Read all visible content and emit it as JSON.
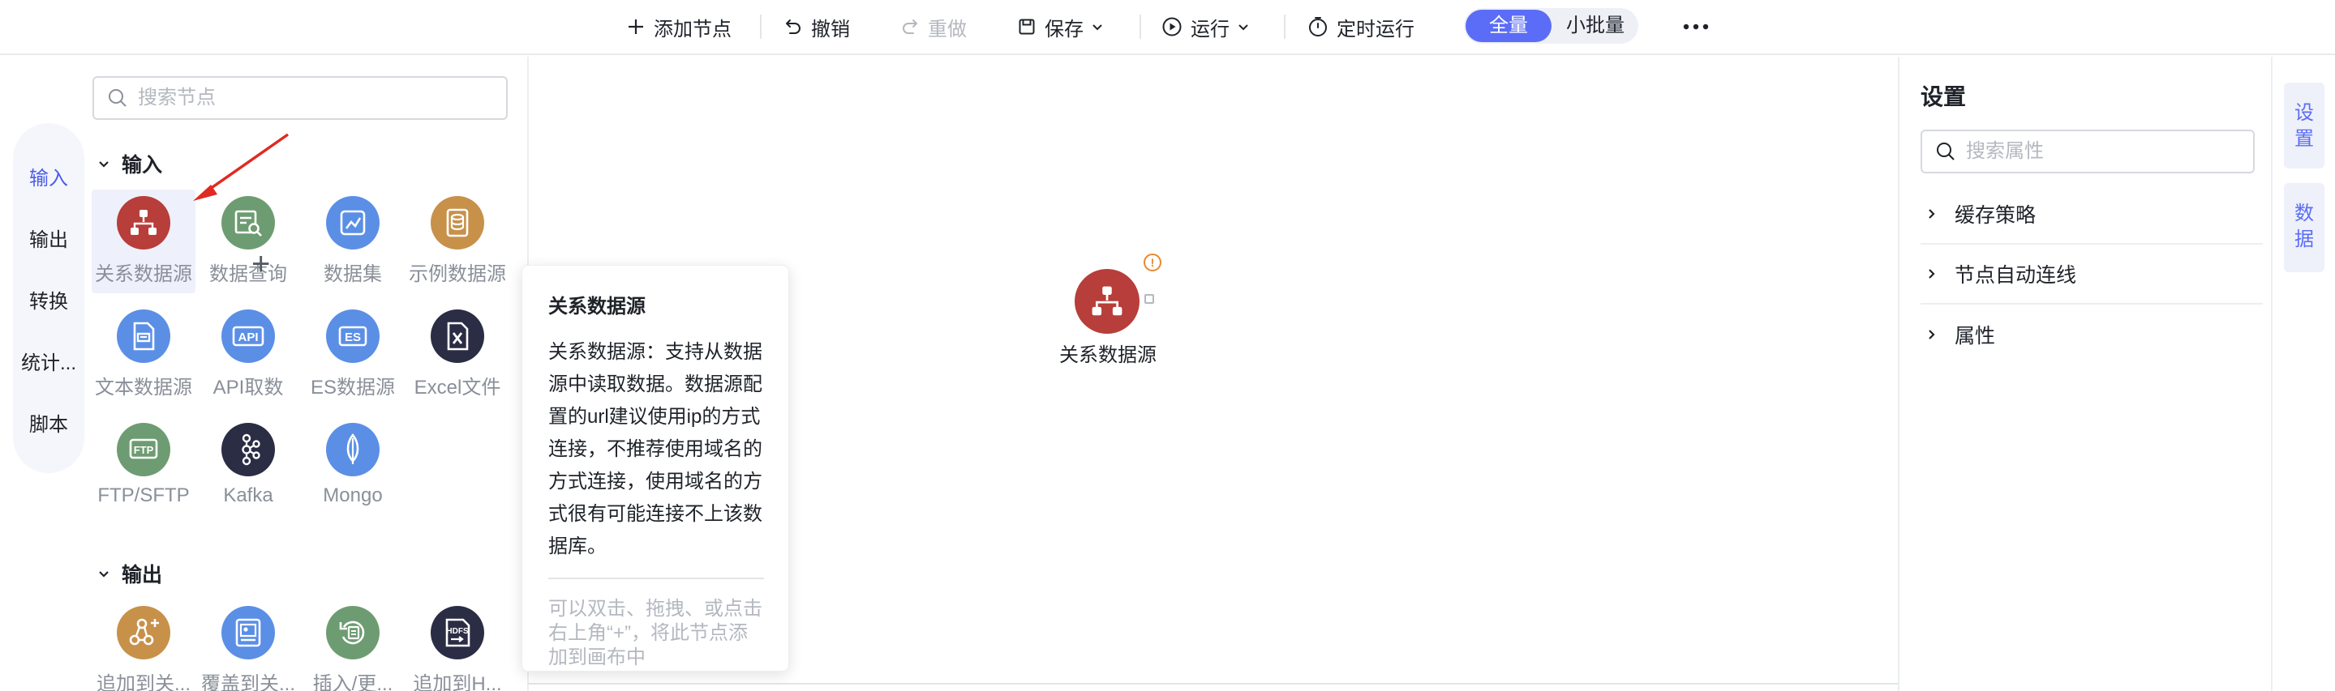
{
  "toolbar": {
    "add_node": "添加节点",
    "undo": "撤销",
    "redo": "重做",
    "save": "保存",
    "run": "运行",
    "schedule": "定时运行",
    "mode_full": "全量",
    "mode_small": "小批量",
    "more_icon": "more-horizontal-icon"
  },
  "rail": {
    "items": [
      {
        "label": "输入",
        "active": true
      },
      {
        "label": "输出",
        "active": false
      },
      {
        "label": "转换",
        "active": false
      },
      {
        "label": "统计...",
        "active": false
      },
      {
        "label": "脚本",
        "active": false
      }
    ]
  },
  "library": {
    "search_placeholder": "搜索节点",
    "groups": [
      {
        "title": "输入",
        "nodes": [
          {
            "label": "关系数据源",
            "icon": "relational-db-icon",
            "color": "#b73e3a"
          },
          {
            "label": "数据查询",
            "icon": "data-query-icon",
            "color": "#6e9c72"
          },
          {
            "label": "数据集",
            "icon": "dataset-icon",
            "color": "#5b8fe6"
          },
          {
            "label": "示例数据源",
            "icon": "sample-db-icon",
            "color": "#c7914a"
          },
          {
            "label": "文本数据源",
            "icon": "text-file-icon",
            "color": "#5b8fe6"
          },
          {
            "label": "API取数",
            "icon": "api-icon",
            "color": "#5b8fe6"
          },
          {
            "label": "ES数据源",
            "icon": "es-icon",
            "color": "#5b8fe6"
          },
          {
            "label": "Excel文件",
            "icon": "excel-icon",
            "color": "#2a2d44"
          },
          {
            "label": "FTP/SFTP",
            "icon": "ftp-icon",
            "color": "#6e9c72"
          },
          {
            "label": "Kafka",
            "icon": "kafka-icon",
            "color": "#2a2d44"
          },
          {
            "label": "Mongo",
            "icon": "mongo-icon",
            "color": "#5b8fe6"
          }
        ]
      },
      {
        "title": "输出",
        "nodes": [
          {
            "label": "追加到关...",
            "icon": "append-relational-icon",
            "color": "#c7914a"
          },
          {
            "label": "覆盖到关...",
            "icon": "overwrite-relational-icon",
            "color": "#5b8fe6"
          },
          {
            "label": "插入/更...",
            "icon": "upsert-icon",
            "color": "#6e9c72"
          },
          {
            "label": "追加到H...",
            "icon": "hdfs-icon",
            "color": "#2a2d44"
          }
        ]
      }
    ]
  },
  "canvas": {
    "node_label": "关系数据源",
    "node_icon": "relational-db-icon",
    "warning_icon": "warning-icon"
  },
  "tooltip": {
    "title": "关系数据源",
    "body": "关系数据源：支持从数据源中读取数据。数据源配置的url建议使用ip的方式连接，不推荐使用域名的方式连接，使用域名的方式很有可能连接不上该数据库。",
    "hint": "可以双击、拖拽、或点击右上角“+”，将此节点添加到画布中"
  },
  "settings": {
    "title": "设置",
    "search_placeholder": "搜索属性",
    "sections": [
      "缓存策略",
      "节点自动连线",
      "属性"
    ]
  },
  "right_tabs": {
    "settings": [
      "设",
      "置"
    ],
    "data": [
      "数",
      "据"
    ]
  }
}
